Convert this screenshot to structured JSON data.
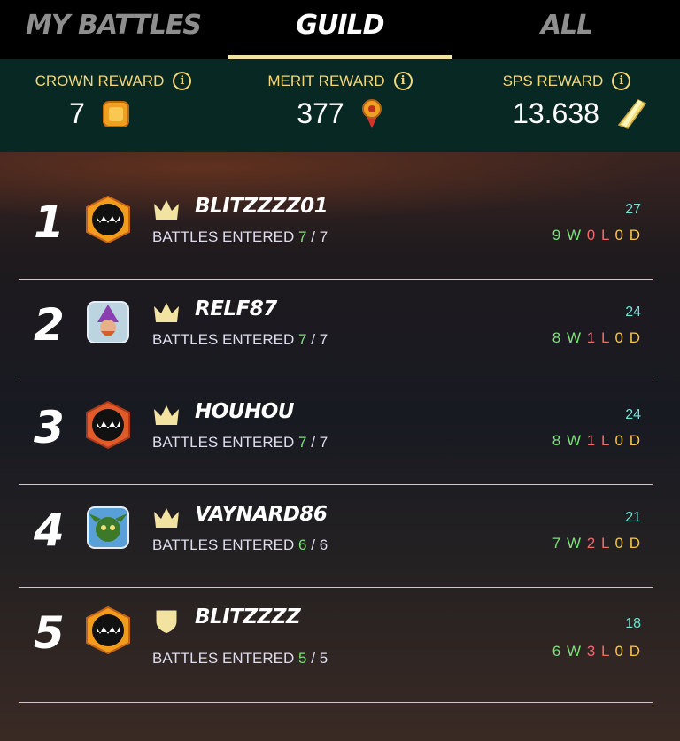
{
  "tabs": [
    {
      "label": "MY BATTLES",
      "active": false
    },
    {
      "label": "GUILD",
      "active": true
    },
    {
      "label": "ALL",
      "active": false
    }
  ],
  "rewards": [
    {
      "label": "CROWN REWARD",
      "value": "7",
      "icon": "crown-token-icon"
    },
    {
      "label": "MERIT REWARD",
      "value": "377",
      "icon": "merit-medal-icon"
    },
    {
      "label": "SPS REWARD",
      "value": "13.638",
      "icon": "sps-crystal-icon"
    }
  ],
  "players": [
    {
      "rank": "1",
      "name": "BLITZZZZ01",
      "battles_label": "BATTLES ENTERED",
      "entered": "7",
      "total": "7",
      "score": "27",
      "w": "9",
      "l": "0",
      "d": "0",
      "badge": "crown",
      "avatar": "monster-orange"
    },
    {
      "rank": "2",
      "name": "RELF87",
      "battles_label": "BATTLES ENTERED",
      "entered": "7",
      "total": "7",
      "score": "24",
      "w": "8",
      "l": "1",
      "d": "0",
      "badge": "crown",
      "avatar": "wizard"
    },
    {
      "rank": "3",
      "name": "HOUHOU",
      "battles_label": "BATTLES ENTERED",
      "entered": "7",
      "total": "7",
      "score": "24",
      "w": "8",
      "l": "1",
      "d": "0",
      "badge": "crown",
      "avatar": "monster-red"
    },
    {
      "rank": "4",
      "name": "VAYNARD86",
      "battles_label": "BATTLES ENTERED",
      "entered": "6",
      "total": "6",
      "score": "21",
      "w": "7",
      "l": "2",
      "d": "0",
      "badge": "crown",
      "avatar": "goblin"
    },
    {
      "rank": "5",
      "name": "BLITZZZZ",
      "battles_label": "BATTLES ENTERED",
      "entered": "5",
      "total": "5",
      "score": "18",
      "w": "6",
      "l": "3",
      "d": "0",
      "badge": "shield",
      "avatar": "monster-orange"
    }
  ],
  "labels": {
    "win": "W",
    "loss": "L",
    "draw": "D",
    "slash": "/"
  },
  "colors": {
    "accent": "#f3d77a",
    "rewards_bg": "#082823",
    "win": "#7ee07a",
    "loss": "#f06a6a",
    "draw": "#f3c64a",
    "score": "#6fe3d5"
  }
}
